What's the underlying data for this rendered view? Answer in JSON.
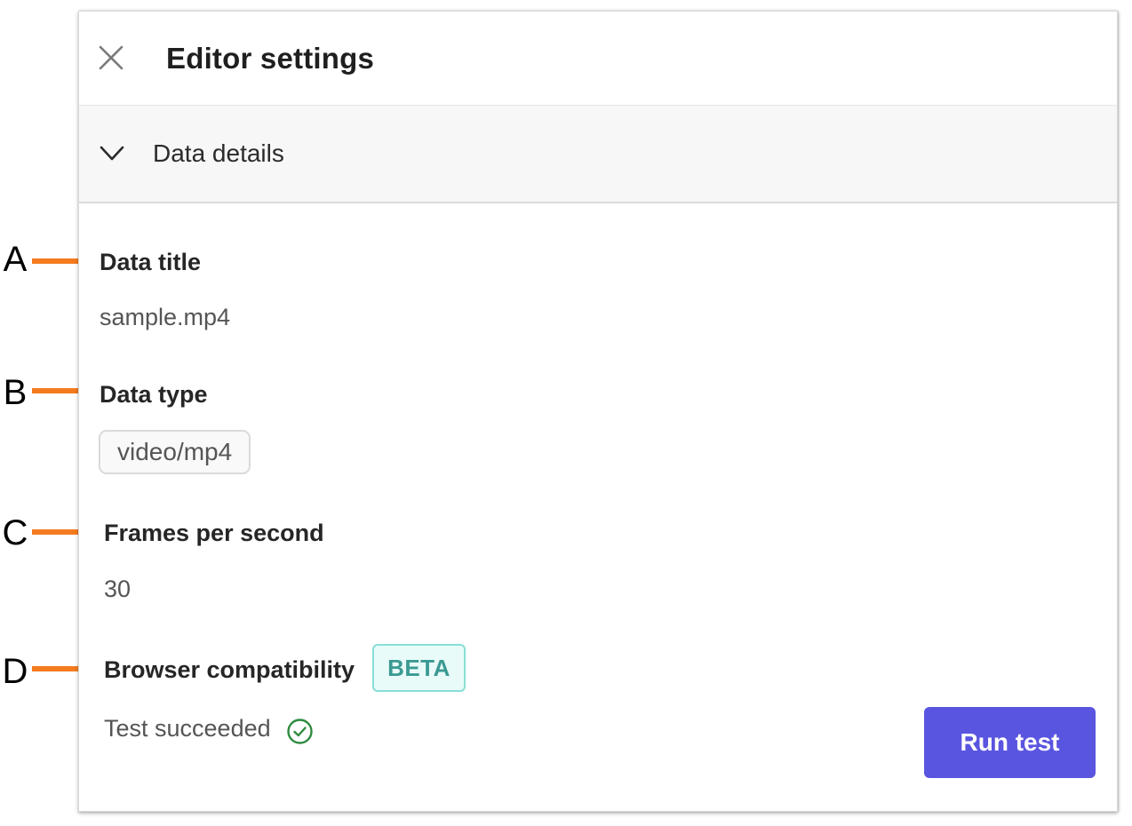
{
  "panel": {
    "title": "Editor settings",
    "section_label": "Data details"
  },
  "fields": {
    "data_title": {
      "label": "Data title",
      "value": "sample.mp4"
    },
    "data_type": {
      "label": "Data type",
      "value": "video/mp4"
    },
    "fps": {
      "label": "Frames per second",
      "value": "30"
    },
    "browser": {
      "label": "Browser compatibility",
      "badge": "BETA",
      "status": "Test succeeded"
    }
  },
  "actions": {
    "run_test_label": "Run test"
  },
  "callouts": [
    "A",
    "B",
    "C",
    "D"
  ],
  "icons": {
    "close": "close-icon",
    "collapse": "chevron-down-icon",
    "status": "check-circle-icon"
  },
  "colors": {
    "callout_line": "#f47b20",
    "primary_button": "#5a55e0",
    "beta_text": "#3a9a93",
    "beta_border": "#87ded6",
    "success": "#2e8b3e"
  }
}
